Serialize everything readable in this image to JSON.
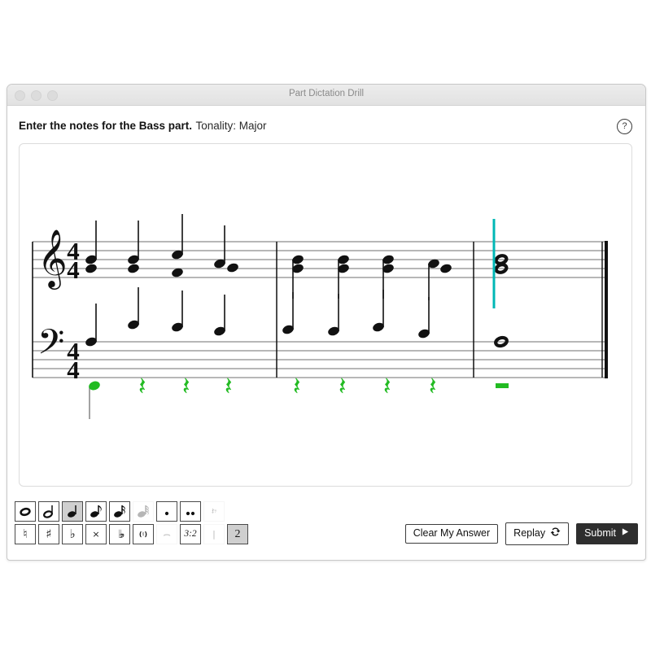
{
  "window": {
    "title": "Part Dictation Drill",
    "traffic_lights": [
      "close-dot",
      "minimize-dot",
      "zoom-dot"
    ]
  },
  "header": {
    "prompt_strong": "Enter the notes for the Bass part.",
    "prompt_normal": "Tonality: Major",
    "help_icon": "help-circle-icon",
    "help_glyph": "?"
  },
  "score": {
    "treble_clef": "treble-clef-icon",
    "bass_clef": "bass-clef-icon",
    "time_signature": {
      "numerator": "4",
      "denominator": "4"
    },
    "measures": 3,
    "cursor_color": "#00b7b5",
    "answer_color": "#22bb22",
    "staff_line_color": "#8c8c8c",
    "notation_color": "#111111",
    "answer_row": {
      "entered_note": "quarter-note",
      "rests": [
        "quarter-rest",
        "quarter-rest",
        "quarter-rest",
        "quarter-rest",
        "quarter-rest",
        "quarter-rest",
        "quarter-rest"
      ],
      "final_rest": "whole-rest"
    }
  },
  "palette_durations": {
    "label": "note-duration-palette",
    "items": [
      {
        "name": "whole-note",
        "icon": "whole-note-icon",
        "state": "enabled"
      },
      {
        "name": "half-note",
        "icon": "half-note-icon",
        "state": "enabled"
      },
      {
        "name": "quarter-note",
        "icon": "quarter-note-icon",
        "state": "selected"
      },
      {
        "name": "eighth-note",
        "icon": "eighth-note-icon",
        "state": "enabled"
      },
      {
        "name": "sixteenth-note",
        "icon": "sixteenth-note-icon",
        "state": "enabled"
      },
      {
        "name": "thirtysecond-note",
        "icon": "thirtysecond-note-icon",
        "state": "disabled"
      },
      {
        "name": "dot",
        "icon": "dot-icon",
        "state": "enabled"
      },
      {
        "name": "double-dot",
        "icon": "double-dot-icon",
        "state": "enabled"
      },
      {
        "name": "rest",
        "icon": "rest-icon",
        "state": "disabled"
      }
    ]
  },
  "palette_accidentals": {
    "label": "accidental-palette",
    "items": [
      {
        "name": "natural",
        "icon": "natural-icon",
        "glyph": "♮",
        "state": "enabled"
      },
      {
        "name": "sharp",
        "icon": "sharp-icon",
        "glyph": "♯",
        "state": "enabled"
      },
      {
        "name": "flat",
        "icon": "flat-icon",
        "glyph": "♭",
        "state": "enabled"
      },
      {
        "name": "double-sharp",
        "icon": "double-sharp-icon",
        "glyph": "×",
        "state": "enabled"
      },
      {
        "name": "double-flat",
        "icon": "double-flat-icon",
        "glyph": "♭♭",
        "state": "enabled"
      },
      {
        "name": "courtesy-accidental",
        "icon": "bracket-accidental-icon",
        "glyph": "(♮)",
        "state": "enabled"
      },
      {
        "name": "tie",
        "icon": "tie-icon",
        "glyph": "⌢",
        "state": "disabled"
      },
      {
        "name": "tuplet",
        "icon": "tuplet-icon",
        "glyph": "3:2",
        "state": "enabled"
      },
      {
        "name": "barline",
        "icon": "barline-icon",
        "glyph": "|",
        "state": "disabled"
      },
      {
        "name": "voice-two",
        "icon": "voice-two-icon",
        "glyph": "2",
        "state": "selected"
      }
    ]
  },
  "actions": {
    "clear_label": "Clear My Answer",
    "replay_label": "Replay",
    "replay_icon": "refresh-icon",
    "submit_label": "Submit",
    "submit_icon": "play-triangle-icon"
  }
}
